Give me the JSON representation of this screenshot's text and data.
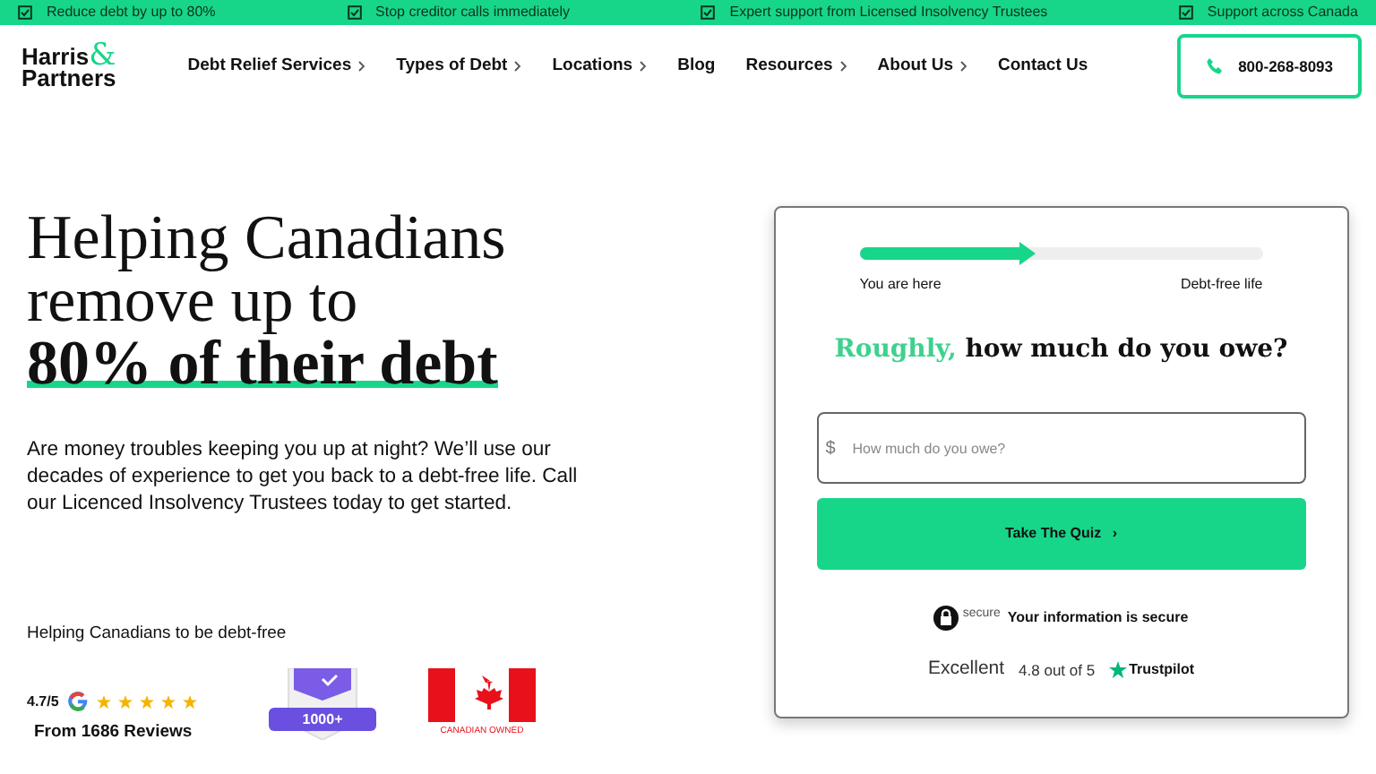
{
  "top_bar": [
    "Reduce debt by up to 80%",
    "Stop creditor calls immediately",
    "Expert support from Licensed Insolvency Trustees",
    "Support across Canada"
  ],
  "logo": {
    "line_1": "Harris",
    "ampersand": "&",
    "line_2": "Partners"
  },
  "nav": [
    {
      "label": "Debt Relief Services",
      "has_menu": true
    },
    {
      "label": "Types of Debt",
      "has_menu": true
    },
    {
      "label": "Locations",
      "has_menu": true
    },
    {
      "label": "Blog",
      "has_menu": false
    },
    {
      "label": "Resources",
      "has_menu": true
    },
    {
      "label": "About Us",
      "has_menu": true
    },
    {
      "label": "Contact Us",
      "has_menu": false
    }
  ],
  "phone": "800-268-8093",
  "hero": {
    "heading": "Helping Canadians remove up to **80% of their debt**",
    "text": "Are money troubles keeping you up at night? We’ll use our decades of experience to get you back to a debt-free life. Call our Licenced Insolvency Trustees today to get started.",
    "tagline": "Helping Canadians to be debt-free"
  },
  "reviews": {
    "rating": "4.7/5",
    "stars": 5,
    "count": "From 1686 Reviews",
    "badge": "1000+",
    "flag_caption": "CANADIAN OWNED"
  },
  "quiz": {
    "progress": {
      "level": 0.42,
      "start": "You are here",
      "end": "Debt-free life"
    },
    "question_highlight": "Roughly,",
    "question": "how much do you owe?",
    "currency": "$",
    "placeholder": "How much do you owe?",
    "button": "Take The Quiz",
    "button_icon": "›",
    "secure_logo": "secure",
    "secure_text": "Your information is secure",
    "rating_word": "Excellent",
    "rating": "4.8 out of 5",
    "trustpilot": "Trustpilot"
  }
}
